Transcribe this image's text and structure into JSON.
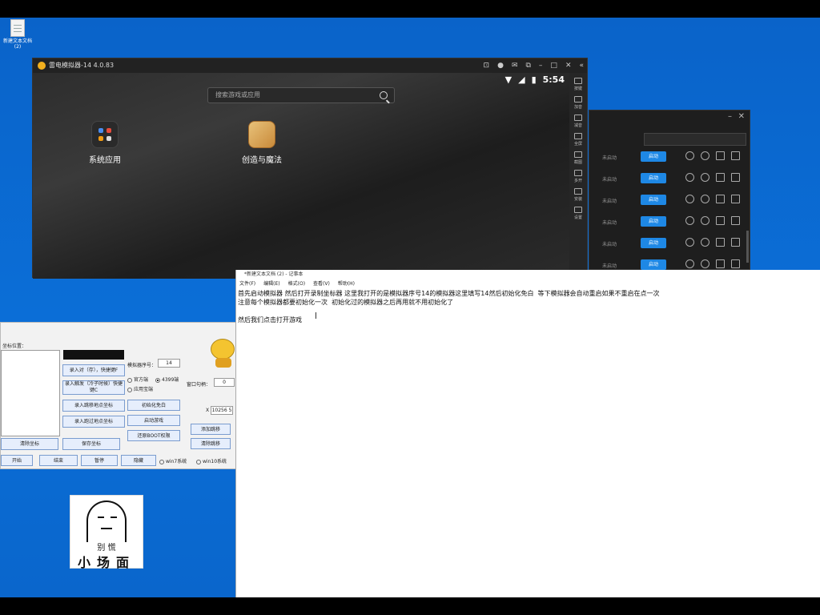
{
  "desktop": {
    "icon_label": "新建文本文档 (2)"
  },
  "emulator": {
    "title": "雷电模拟器-14 4.0.83",
    "clock": "5:54",
    "search_placeholder": "搜索游戏或应用",
    "apps": [
      {
        "label": "系统应用",
        "icon": "system-apps-icon"
      },
      {
        "label": "创造与魔法",
        "icon": "game-icon"
      }
    ],
    "side_items": [
      "按键",
      "加音",
      "减音",
      "全屏",
      "截图",
      "多开",
      "安装",
      "设置"
    ]
  },
  "multi_instance": {
    "rows": [
      {
        "status": "未启动",
        "button": "启动"
      },
      {
        "status": "未启动",
        "button": "启动"
      },
      {
        "status": "未启动",
        "button": "启动"
      },
      {
        "status": "未启动",
        "button": "启动"
      },
      {
        "status": "未启动",
        "button": "启动"
      },
      {
        "status": "未启动",
        "button": "启动"
      }
    ]
  },
  "tool": {
    "coord_label": "坐标位置：",
    "record_fixed": "录入对（存），快捷键F",
    "record_chain": "录入触发（冷子时候）快捷键C",
    "record_jump": "录入跳移地点坐标",
    "record_pass": "录入跑过地点坐标",
    "clear_coords": "清除坐标",
    "save_coords": "保存坐标",
    "emu_index_label": "模拟器序号：",
    "emu_index_value": "14",
    "radio_official": "官方端",
    "radio_4399": "4399端",
    "radio_app": "应用宝端",
    "init_btn": "初始化免白",
    "start_game": "启动游戏",
    "restore_boot": "还原BOOT权限",
    "window_handle_label": "窗口句柄：",
    "window_handle_value": "0",
    "x_label": "X",
    "x_value": "10256 5",
    "add_jump": "添加跳移",
    "clear_jump": "清除跳移",
    "start": "开始",
    "end": "结束",
    "pause": "暂停",
    "hide": "隐藏",
    "win7": "win7系统",
    "win10": "win10系统"
  },
  "meme": {
    "line1": "别 慌",
    "line2": "小场面"
  },
  "notepad": {
    "title": "*新建文本文档 (2) - 记事本",
    "menu": [
      "文件(F)",
      "编辑(E)",
      "格式(O)",
      "查看(V)",
      "帮助(H)"
    ],
    "text": "首先启动模拟器 然后打开录制坐标器 这里我打开的是模拟器序号14的模拟器这里填写14然后初始化免白  等下模拟器会自动重启如果不重启在点一次\n注意每个模拟器都要初始化一次  初始化过的模拟器之后再用就不用初始化了\n\n然后我们点击打开游戏"
  }
}
